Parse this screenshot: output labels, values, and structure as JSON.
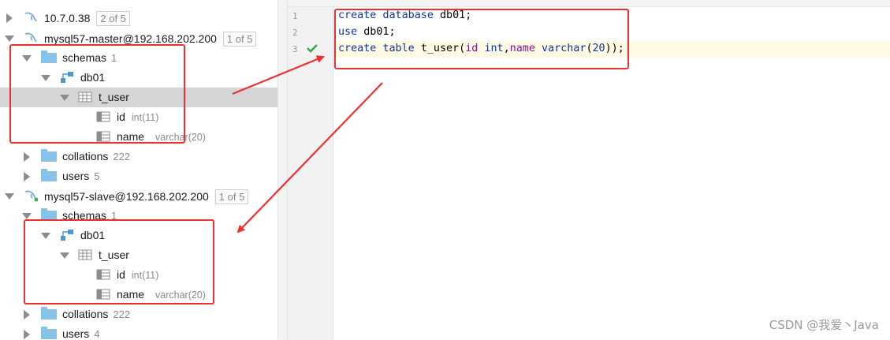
{
  "tree": {
    "conn1": {
      "host": "10.7.0.38",
      "badge": "2 of 5"
    },
    "conn2": {
      "label": "mysql57-master@192.168.202.200",
      "badge": "1 of 5",
      "schemas": {
        "label": "schemas",
        "count": "1"
      },
      "db": {
        "label": "db01"
      },
      "table": {
        "label": "t_user"
      },
      "col1": {
        "name": "id",
        "type": "int(11)"
      },
      "col2": {
        "name": "name",
        "type": "varchar(20)"
      },
      "collations": {
        "label": "collations",
        "count": "222"
      },
      "users": {
        "label": "users",
        "count": "5"
      }
    },
    "conn3": {
      "label": "mysql57-slave@192.168.202.200",
      "badge": "1 of 5",
      "schemas": {
        "label": "schemas",
        "count": "1"
      },
      "db": {
        "label": "db01"
      },
      "table": {
        "label": "t_user"
      },
      "col1": {
        "name": "id",
        "type": "int(11)"
      },
      "col2": {
        "name": "name",
        "type": "varchar(20)"
      },
      "collations": {
        "label": "collations",
        "count": "222"
      },
      "users": {
        "label": "users",
        "count": "4"
      }
    }
  },
  "editor": {
    "line_numbers": [
      "1",
      "2",
      "3"
    ],
    "lines": [
      {
        "kw1": "create",
        "kw2": "database",
        "rest": "db01;"
      },
      {
        "kw1": "use",
        "rest": "db01;"
      },
      {
        "kw1": "create",
        "kw2": "table",
        "name": "t_user(",
        "c1": "id",
        "t1": "int",
        "comma": ",",
        "c2": "name",
        "t2": "varchar",
        "p": "(",
        "n": "20",
        "end": "));"
      }
    ]
  },
  "watermark": "CSDN @我爱丶Java",
  "colors": {
    "annotation_red": "#f03030",
    "keyword_blue": "#0b33a8",
    "identifier_purple": "#871094",
    "selection_gray": "#d5d5d5"
  }
}
